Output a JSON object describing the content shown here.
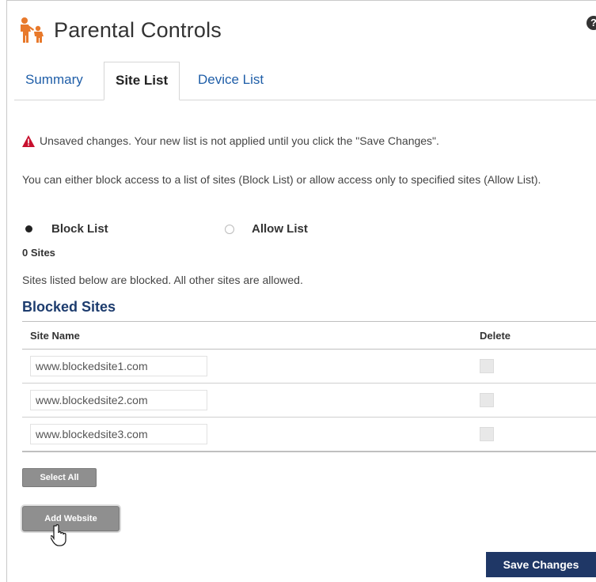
{
  "header": {
    "title": "Parental Controls",
    "logo_icon": "family-icon",
    "help_icon": "help-icon",
    "help_glyph": "?"
  },
  "tabs": [
    {
      "label": "Summary",
      "active": false
    },
    {
      "label": "Site List",
      "active": true
    },
    {
      "label": "Device List",
      "active": false
    }
  ],
  "warning": {
    "icon": "warning-icon",
    "text": "Unsaved changes. Your new list is not applied until you click the \"Save Changes\"."
  },
  "description": "You can either block access to a list of sites (Block List) or allow access only to specified sites (Allow List).",
  "list_mode": {
    "options": [
      {
        "label": "Block List",
        "selected": true
      },
      {
        "label": "Allow List",
        "selected": false
      }
    ]
  },
  "sites_count": "0 Sites",
  "note": "Sites listed below are blocked. All other sites are allowed.",
  "section_title": "Blocked Sites",
  "table": {
    "columns": [
      "Site Name",
      "Delete"
    ],
    "rows": [
      {
        "site": "www.blockedsite1.com",
        "delete": false
      },
      {
        "site": "www.blockedsite2.com",
        "delete": false
      },
      {
        "site": "www.blockedsite3.com",
        "delete": false
      }
    ]
  },
  "buttons": {
    "select_all": "Select All",
    "add_website": "Add Website",
    "save_changes": "Save Changes"
  },
  "colors": {
    "accent_orange": "#e8792b",
    "link_blue": "#1f5ea8",
    "title_navy": "#1d3c6e",
    "save_button": "#1f3766",
    "warning_red": "#c8102e"
  }
}
